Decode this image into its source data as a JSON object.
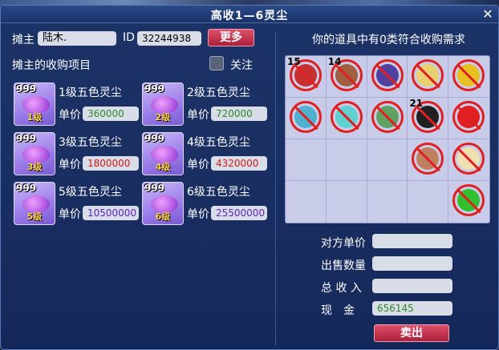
{
  "window": {
    "title": "高收1—6灵尘",
    "close_glyph": "✕"
  },
  "header": {
    "owner_label": "摊主",
    "owner_name": "陆木.",
    "id_label": "ID",
    "id_value": "32244938",
    "more_button": "更多",
    "projects_label": "摊主的收购项目",
    "follow_label": "关注"
  },
  "items": [
    {
      "qty": "999",
      "level": "1级",
      "name": "1级五色灵尘",
      "price_label": "单价",
      "price": "360000",
      "price_color": "green"
    },
    {
      "qty": "999",
      "level": "2级",
      "name": "2级五色灵尘",
      "price_label": "单价",
      "price": "720000",
      "price_color": "green"
    },
    {
      "qty": "999",
      "level": "3级",
      "name": "3级五色灵尘",
      "price_label": "单价",
      "price": "1800000",
      "price_color": "red"
    },
    {
      "qty": "999",
      "level": "4级",
      "name": "4级五色灵尘",
      "price_label": "单价",
      "price": "4320000",
      "price_color": "red"
    },
    {
      "qty": "999",
      "level": "5级",
      "name": "5级五色灵尘",
      "price_label": "单价",
      "price": "10500000",
      "price_color": "purple"
    },
    {
      "qty": "999",
      "level": "6级",
      "name": "6级五色灵尘",
      "price_label": "单价",
      "price": "25500000",
      "price_color": "purple"
    }
  ],
  "bag": {
    "heading": "你的道具中有0类符合收购需求",
    "slots": [
      {
        "qty": "15",
        "icon": "scroll-icon",
        "color": "#c83030"
      },
      {
        "qty": "14",
        "icon": "drum-icon",
        "color": "#a06040"
      },
      {
        "qty": "",
        "icon": "book-icon",
        "color": "#5040a0"
      },
      {
        "qty": "",
        "icon": "skull-icon",
        "color": "#e8d070"
      },
      {
        "qty": "",
        "icon": "flag-icon",
        "color": "#e8c020"
      },
      {
        "qty": "",
        "icon": "fish-icon",
        "color": "#50b0d0"
      },
      {
        "qty": "",
        "icon": "gem-icon",
        "color": "#60d0d0"
      },
      {
        "qty": "",
        "icon": "bowl-icon",
        "color": "#60a060"
      },
      {
        "qty": "21",
        "icon": "talisman-icon",
        "color": "#202020"
      },
      {
        "qty": "",
        "icon": "flag-icon",
        "color": "#e02020"
      },
      {
        "qty": "",
        "icon": "",
        "color": ""
      },
      {
        "qty": "",
        "icon": "",
        "color": ""
      },
      {
        "qty": "",
        "icon": "",
        "color": ""
      },
      {
        "qty": "",
        "icon": "bowl-icon",
        "color": "#c08060"
      },
      {
        "qty": "",
        "icon": "skull-icon",
        "color": "#f0e0b0"
      },
      {
        "qty": "",
        "icon": "",
        "color": ""
      },
      {
        "qty": "",
        "icon": "",
        "color": ""
      },
      {
        "qty": "",
        "icon": "",
        "color": ""
      },
      {
        "qty": "",
        "icon": "",
        "color": ""
      },
      {
        "qty": "",
        "icon": "flag-icon",
        "color": "#30c030"
      }
    ]
  },
  "sell": {
    "unit_price_label": "对方单价",
    "sell_qty_label": "出售数量",
    "total_label": "总 收 入",
    "cash_label": "现　金",
    "unit_price": "",
    "sell_qty": "",
    "total": "",
    "cash": "656145",
    "sell_button": "卖出"
  }
}
